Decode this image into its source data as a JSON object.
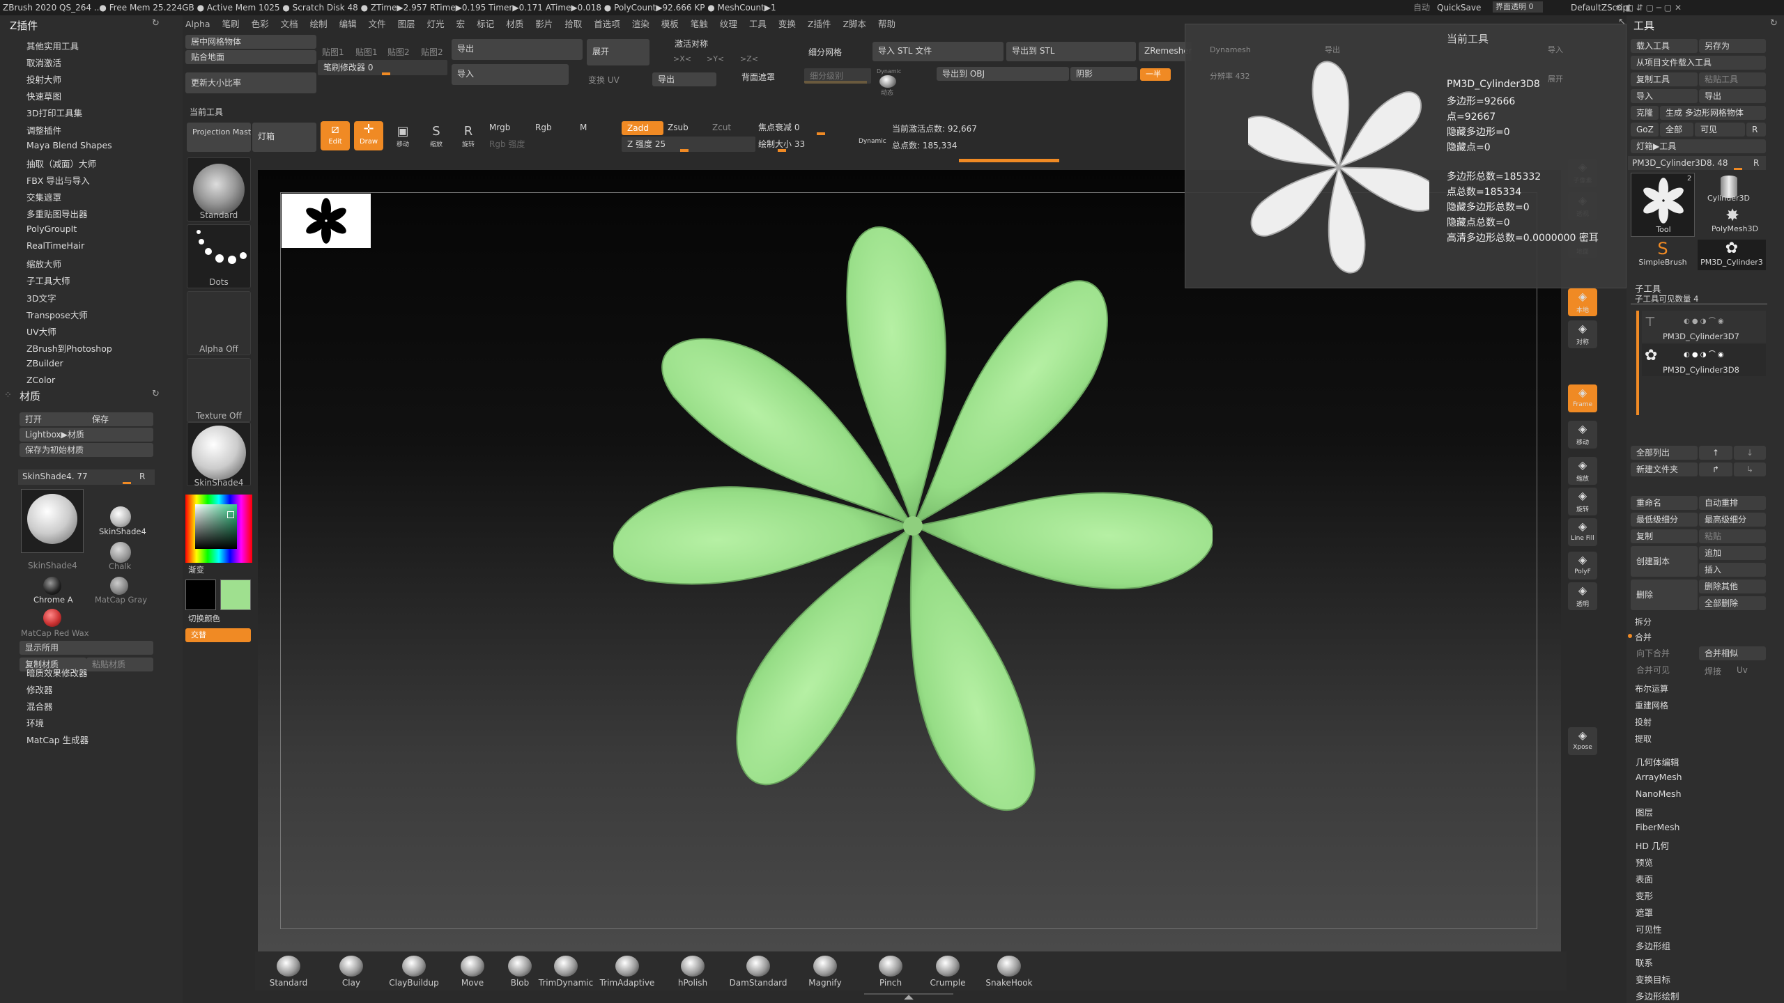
{
  "titlebar": {
    "status": "ZBrush 2020   QS_264   ..● Free Mem 25.224GB ● Active Mem 1025 ● Scratch Disk 48 ● ZTime▶2.957 RTime▶0.195 Timer▶0.171 ATime▶0.018 ● PolyCount▶92.666 KP ● MeshCount▶1",
    "auto": "自动",
    "quicksave": "QuickSave",
    "transparency": "界面透明 0",
    "script": "DefaultZScript"
  },
  "menu": [
    "Alpha",
    "笔刷",
    "色彩",
    "文档",
    "绘制",
    "编辑",
    "文件",
    "图层",
    "灯光",
    "宏",
    "标记",
    "材质",
    "影片",
    "拾取",
    "首选项",
    "渲染",
    "模板",
    "笔触",
    "纹理",
    "工具",
    "变换",
    "Z插件",
    "Z脚本",
    "帮助"
  ],
  "left_panel": {
    "zplugin_title": "Z插件",
    "zplugin_items": [
      "其他实用工具",
      "取消激活",
      "投射大师",
      "快速草图",
      "3D打印工具集",
      "调整插件",
      "Maya Blend Shapes",
      "抽取（减面）大师",
      "FBX 导出与导入",
      "交集遮罩",
      "多重贴图导出器",
      "PolyGroupIt",
      "RealTimeHair",
      "缩放大师",
      "子工具大师",
      "3D文字",
      "Transpose大师",
      "UV大师",
      "ZBrush到Photoshop",
      "ZBuilder",
      "ZColor"
    ],
    "material_title": "材质",
    "open": "打开",
    "save": "保存",
    "lightbox": "Lightbox▶材质",
    "save_default": "保存为初始材质",
    "current_material": "SkinShade4. 77",
    "r": "R",
    "materials": [
      "SkinShade4",
      "SkinShade4",
      "Chalk",
      "Chrome A",
      "MatCap Gray",
      "MatCap Red Wax"
    ],
    "show_used": "显示所用",
    "copy_mat": "复制材质",
    "paste_mat": "粘贴材质",
    "more": [
      "暗质效果修改器",
      "修改器",
      "混合器",
      "环境",
      "MatCap 生成器"
    ]
  },
  "top_toolbar": {
    "center_mesh": "居中网格物体",
    "floor": "贴合地面",
    "update_size": "更新大小比率",
    "map1": "贴图1",
    "map2": "贴图1",
    "map3": "贴图2",
    "map4": "贴图2",
    "brush_modifier": "笔刷修改器 0",
    "export": "导出",
    "import": "导入",
    "expand": "展开",
    "uv": "变换 UV",
    "export2": "导出",
    "symmetry": "激活对称",
    "x": ">X<",
    "y": ">Y<",
    "z": ">Z<",
    "backface": "背面遮罩",
    "subdiv": "细分网格",
    "subdiv_level": "细分级别",
    "dynamic": "Dynamic",
    "dynamic2": "动态",
    "import_stl": "导入 STL 文件",
    "export_stl": "导出到 STL",
    "export_obj": "导出到 OBJ",
    "shadow": "阴影",
    "zremesher": "ZRemesher",
    "half": "一半",
    "current_tool": "当前工具",
    "projection_master": "Projection Master",
    "lightbox": "灯箱",
    "edit": "Edit",
    "draw": "Draw",
    "move": "移动",
    "scale": "缩放",
    "rotate": "旋转",
    "mrgb": "Mrgb",
    "rgb": "Rgb",
    "m": "M",
    "rgb_intensity": "Rgb 强度",
    "zadd": "Zadd",
    "zsub": "Zsub",
    "zcut": "Zcut",
    "z_intensity": "Z 强度 25",
    "focal": "焦点衰减 0",
    "draw_size": "绘制大小 33",
    "dynamic_label": "Dynamic",
    "active_points": "当前激活点数: 92,667",
    "total_points": "总点数: 185,334",
    "dynamesh": "Dynamesh",
    "resolution": "分辨率 432",
    "export3": "导出",
    "import3": "导入",
    "expand2": "展开"
  },
  "tool_column": {
    "thumbs": [
      "Standard",
      "Dots",
      "Alpha Off",
      "Texture Off",
      "SkinShade4"
    ],
    "gradient": "渐变",
    "switch_color": "切换颜色",
    "alternate": "交替"
  },
  "popup": {
    "title": "当前工具",
    "name": "PM3D_Cylinder3D8",
    "polys": "多边形=92666",
    "points": "点=92667",
    "hidden_polys": "隐藏多边形=0",
    "hidden_points": "隐藏点=0",
    "total_polys": "多边形总数=185332",
    "total_points": "点总数=185334",
    "hidden_total_polys": "隐藏多边形总数=0",
    "hidden_total_points": "隐藏点总数=0",
    "hd_density": "高清多边形总数=0.0000000 密耳"
  },
  "right_icons": [
    "子像素",
    "透视",
    "地面",
    "本地",
    "对称",
    "Frame",
    "移动",
    "缩放",
    "旋转",
    "Line Fill",
    "PolyF",
    "透明",
    "Xpose"
  ],
  "right_panel": {
    "title": "工具",
    "load": "载入工具",
    "saveas": "另存为",
    "from_project": "从项目文件载入工具",
    "copy": "复制工具",
    "paste": "粘贴工具",
    "import": "导入",
    "export": "导出",
    "clone": "克隆",
    "make_poly": "生成 多边形网格物体",
    "goz": "GoZ",
    "all": "全部",
    "visible": "可见",
    "r": "R",
    "lightbox_tool": "灯箱▶工具",
    "current": "PM3D_Cylinder3D8. 48",
    "r2": "R",
    "tools": [
      "Tool",
      "Cylinder3D",
      "SimpleBrush",
      "PolyMesh3D",
      "PM3D_Cylinder3"
    ],
    "count2": "2",
    "subtool_title": "子工具",
    "subtool_count": "子工具可见数量 4",
    "subtools": [
      "PM3D_Cylinder3D7",
      "PM3D_Cylinder3D8"
    ],
    "list_all": "全部列出",
    "new_folder": "新建文件夹",
    "rename": "重命名",
    "auto_reorder": "自动重排",
    "lowest": "最低级细分",
    "highest": "最高级细分",
    "duplicate": "复制",
    "paste2": "粘贴",
    "append": "追加",
    "insert": "插入",
    "create_copy": "创建副本",
    "delete": "删除",
    "delete_other": "删除其他",
    "delete_all": "全部删除",
    "split": "拆分",
    "merge": "合并",
    "merge_down": "向下合并",
    "merge_similar": "合并相似",
    "merge_visible": "合并可见",
    "weld": "焊接",
    "uv": "Uv",
    "boolean": "布尔运算",
    "remesh": "重建网格",
    "project": "投射",
    "extract": "提取",
    "more": [
      "几何体编辑",
      "ArrayMesh",
      "NanoMesh",
      "图层",
      "FiberMesh",
      "HD 几何",
      "预览",
      "表面",
      "变形",
      "遮罩",
      "可见性",
      "多边形组",
      "联系",
      "变换目标",
      "多边形绘制"
    ]
  },
  "brushes": [
    "Standard",
    "Clay",
    "ClayBuildup",
    "Move",
    "Blob",
    "TrimDynamic",
    "TrimAdaptive",
    "hPolish",
    "DamStandard",
    "Magnify",
    "Pinch",
    "Crumple",
    "SnakeHook"
  ],
  "colors": {
    "leaf": "#9fe08f",
    "accent": "#f08a24"
  }
}
